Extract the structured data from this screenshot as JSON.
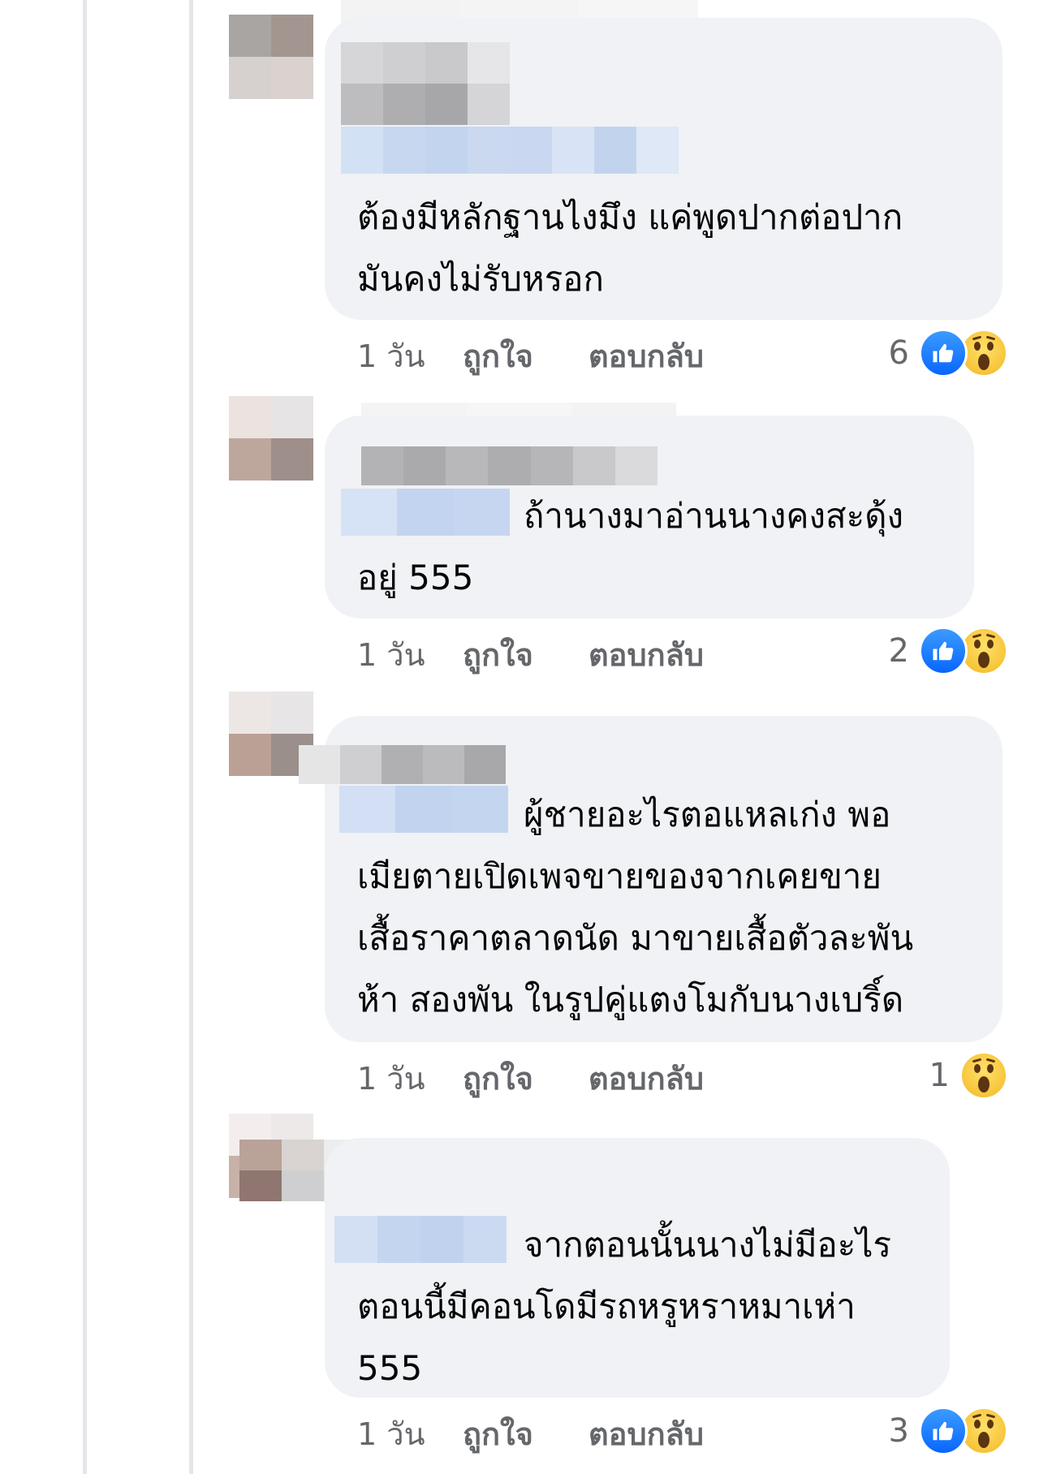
{
  "comments": [
    {
      "text_line1": "ต้องมีหลักฐานไงมึง แค่พูดปากต่อปาก",
      "text_line2": "มันคงไม่รับหรอก",
      "time": "1 วัน",
      "like_label": "ถูกใจ",
      "reply_label": "ตอบกลับ",
      "reaction_count": "6",
      "reactions": [
        "like-reaction-icon",
        "wow-reaction-icon"
      ]
    },
    {
      "text_line1": "ถ้านางมาอ่านนางคงสะดุ้ง",
      "text_line2": "อยู่ 555",
      "time": "1 วัน",
      "like_label": "ถูกใจ",
      "reply_label": "ตอบกลับ",
      "reaction_count": "2",
      "reactions": [
        "like-reaction-icon",
        "wow-reaction-icon"
      ]
    },
    {
      "text_line1": "ผู้ชายอะไรตอแหลเก่ง พอ",
      "text_line2": "เมียตายเปิดเพจขายของจากเคยขาย",
      "text_line3": "เสื้อราคาตลาดนัด มาขายเสื้อตัวละพัน",
      "text_line4": "ห้า สองพัน ในรูปคู่แตงโมกับนางเบริ์ด",
      "time": "1 วัน",
      "like_label": "ถูกใจ",
      "reply_label": "ตอบกลับ",
      "reaction_count": "1",
      "reactions": [
        "wow-reaction-icon"
      ]
    },
    {
      "text_line1": "จากตอนนั้นนางไม่มีอะไร",
      "text_line2": "ตอนนี้มีคอนโดมีรถหรูหราหมาเห่า",
      "text_line3": "555",
      "time": "1 วัน",
      "like_label": "ถูกใจ",
      "reply_label": "ตอบกลับ",
      "reaction_count": "3",
      "reactions": [
        "like-reaction-icon",
        "wow-reaction-icon"
      ]
    }
  ],
  "colors": {
    "bubble": "#f0f2f5",
    "meta_text": "#65676b",
    "like_blue": "#0866ff",
    "wow_yellow": "#f7c33b",
    "blur_gray": "#c9c9c9",
    "blur_blue": "#c8d8ef"
  }
}
